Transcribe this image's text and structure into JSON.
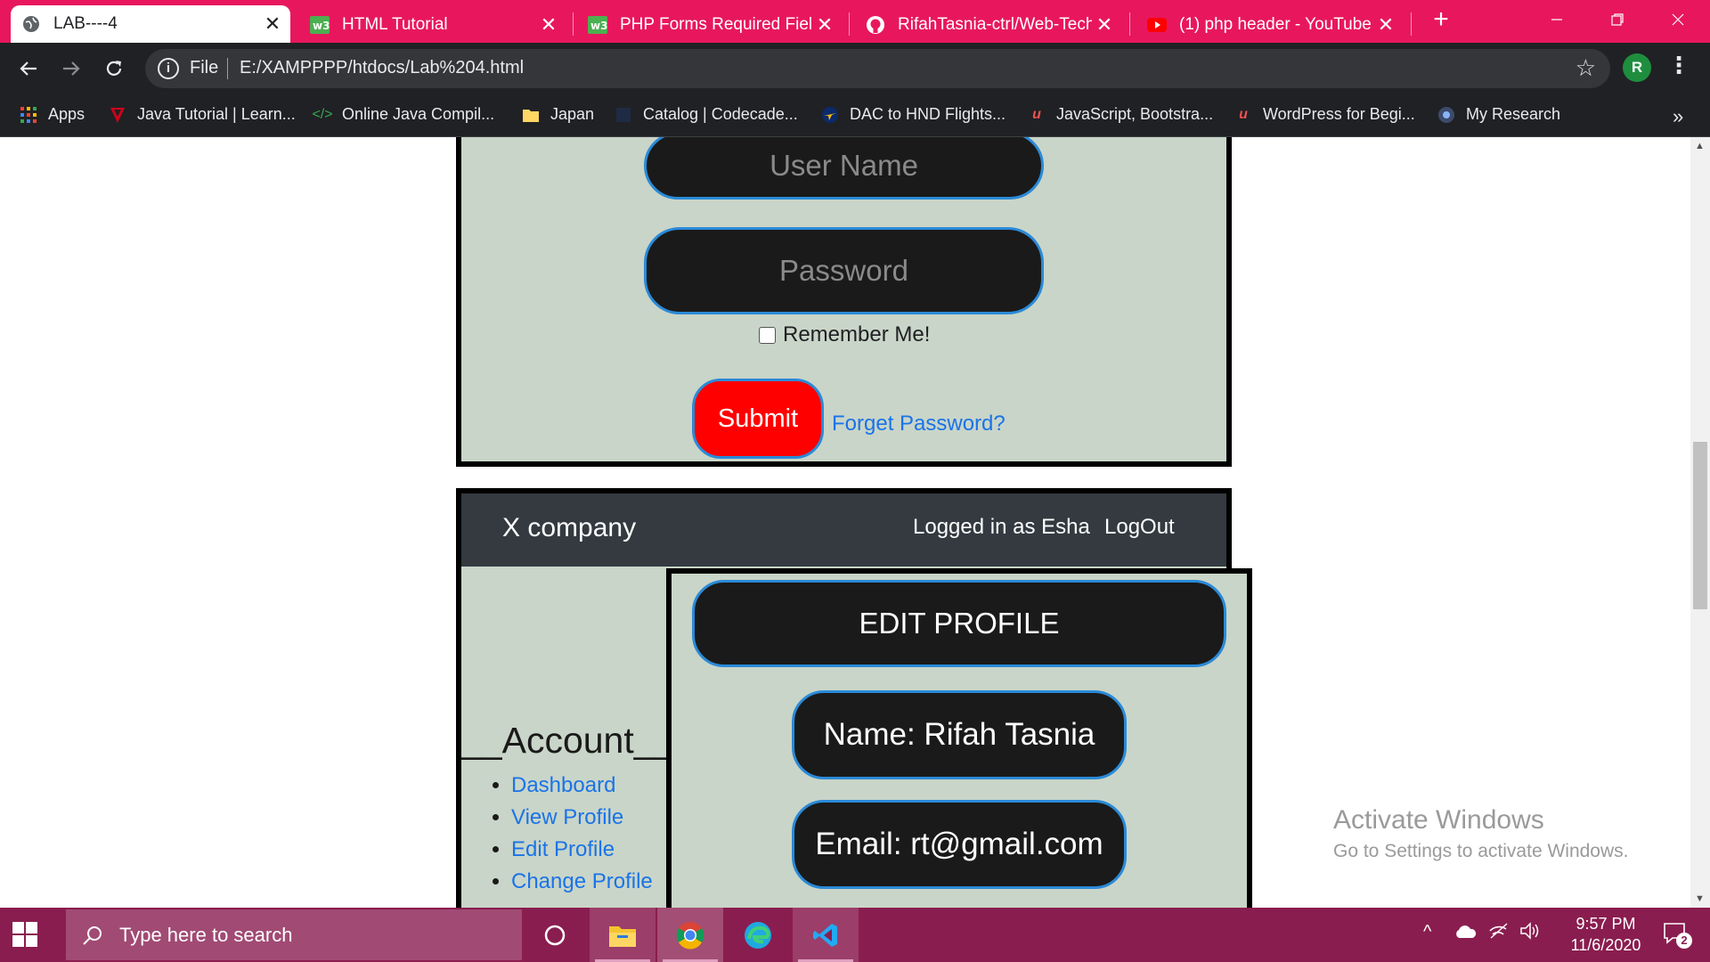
{
  "browser": {
    "tabs": [
      {
        "title": "LAB----4",
        "icon": "globe-icon",
        "active": true
      },
      {
        "title": "HTML Tutorial",
        "icon": "w3schools-icon",
        "active": false
      },
      {
        "title": "PHP Forms Required Fields",
        "icon": "w3schools-icon",
        "active": false
      },
      {
        "title": "RifahTasnia-ctrl/Web-Techn",
        "icon": "github-icon",
        "active": false
      },
      {
        "title": "(1) php header - YouTube",
        "icon": "youtube-icon",
        "active": false
      }
    ],
    "new_tab": "+",
    "address": {
      "scheme": "File",
      "url": "E:/XAMPPPP/htdocs/Lab%204.html"
    },
    "profile_initial": "R",
    "bookmarks": [
      {
        "label": "Apps",
        "icon": "apps-grid-icon"
      },
      {
        "label": "Java Tutorial | Learn...",
        "icon": "java-icon"
      },
      {
        "label": "Online Java Compil...",
        "icon": "code-icon"
      },
      {
        "label": "Japan",
        "icon": "folder-icon"
      },
      {
        "label": "Catalog | Codecade...",
        "icon": "codecademy-icon"
      },
      {
        "label": "DAC to HND Flights...",
        "icon": "plane-icon"
      },
      {
        "label": "JavaScript, Bootstra...",
        "icon": "udemy-icon"
      },
      {
        "label": "WordPress for Begi...",
        "icon": "udemy-icon"
      },
      {
        "label": "My Research",
        "icon": "research-icon"
      }
    ],
    "bookmarks_more": "»",
    "colors": {
      "tab_bar": "#e8175d",
      "toolbar": "#202124"
    }
  },
  "login_form": {
    "username_placeholder": "User Name",
    "password_placeholder": "Password",
    "remember_label": "Remember Me!",
    "submit_label": "Submit",
    "forgot_label": "Forget Password?"
  },
  "dashboard": {
    "brand": "X company",
    "logged_in_text": "Logged in as Esha",
    "logout_label": "LogOut",
    "sidebar_heading": "__Account__",
    "sidebar_links": [
      "Dashboard",
      "View Profile",
      "Edit Profile",
      "Change Profile"
    ],
    "content_title": "EDIT PROFILE",
    "name_field": "Name: Rifah Tasnia",
    "email_field": "Email: rt@gmail.com",
    "colors": {
      "panel": "#c9d5c8",
      "header": "#343a40",
      "pill": "#1a1a1a",
      "pill_border": "#2a8ad8",
      "submit": "#ff0000",
      "link": "#1a73e8"
    }
  },
  "watermark": {
    "title": "Activate Windows",
    "subtitle": "Go to Settings to activate Windows."
  },
  "taskbar": {
    "search_placeholder": "Type here to search",
    "time": "9:57 PM",
    "date": "11/6/2020",
    "notification_count": "2",
    "apps": [
      "task-view-icon",
      "file-explorer-icon",
      "chrome-icon",
      "edge-icon",
      "vscode-icon"
    ]
  }
}
